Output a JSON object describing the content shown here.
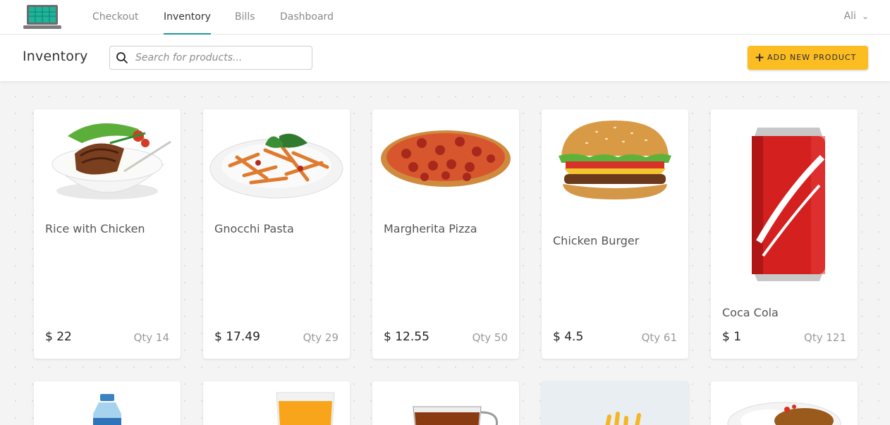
{
  "nav": {
    "tabs": [
      {
        "label": "Checkout"
      },
      {
        "label": "Inventory"
      },
      {
        "label": "Bills"
      },
      {
        "label": "Dashboard"
      }
    ],
    "active_tab": "Inventory",
    "user": "Ali"
  },
  "header": {
    "title": "Inventory",
    "search_placeholder": "Search for products...",
    "add_button_label": "ADD NEW PRODUCT"
  },
  "colors": {
    "accent_teal": "#1d9a9c",
    "button_yellow": "#fbbd22"
  },
  "products": [
    {
      "name": "Rice with Chicken",
      "price": "$ 22",
      "qty": "Qty 14",
      "icon": "rice-with-chicken-image"
    },
    {
      "name": "Gnocchi Pasta",
      "price": "$ 17.49",
      "qty": "Qty 29",
      "icon": "pasta-image"
    },
    {
      "name": "Margherita Pizza",
      "price": "$ 12.55",
      "qty": "Qty 50",
      "icon": "pizza-image"
    },
    {
      "name": "Chicken Burger",
      "price": "$ 4.5",
      "qty": "Qty 61",
      "icon": "burger-image"
    },
    {
      "name": "Coca Cola",
      "price": "$ 1",
      "qty": "Qty 121",
      "icon": "cola-can-image"
    }
  ],
  "partial_products": [
    {
      "icon": "water-bottle-image"
    },
    {
      "icon": "orange-juice-image"
    },
    {
      "icon": "tea-cup-image"
    },
    {
      "icon": "fries-image"
    },
    {
      "icon": "curry-rice-image"
    }
  ]
}
